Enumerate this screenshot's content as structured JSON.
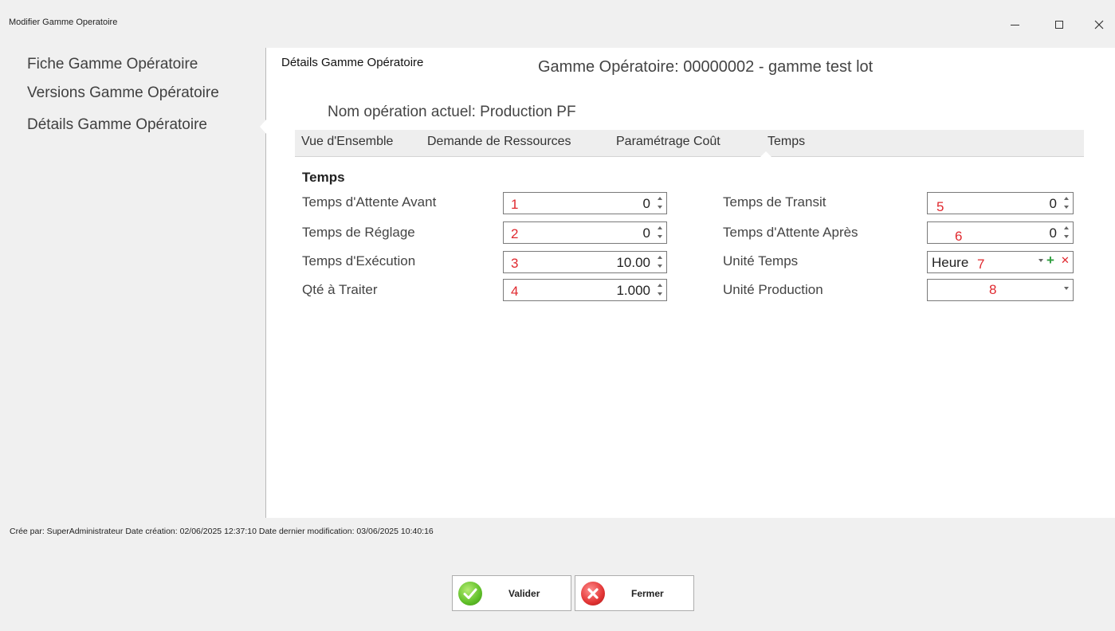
{
  "window": {
    "title": "Modifier Gamme Operatoire"
  },
  "sidebar": {
    "items": [
      {
        "label": "Fiche Gamme Opératoire"
      },
      {
        "label": "Versions Gamme Opératoire"
      },
      {
        "label": "Détails Gamme Opératoire"
      }
    ],
    "selected_index": 2
  },
  "main": {
    "section_title": "Détails Gamme Opératoire",
    "gamme_title": "Gamme Opératoire: 00000002 - gamme test lot",
    "operation_name": "Nom opération actuel: Production PF",
    "tabs": [
      {
        "label": "Vue d'Ensemble"
      },
      {
        "label": "Demande de Ressources"
      },
      {
        "label": "Paramétrage Coût"
      },
      {
        "label": "Temps"
      }
    ],
    "active_tab": "Temps",
    "group_title": "Temps",
    "fields": {
      "attente_avant": {
        "label": "Temps d'Attente Avant",
        "value": "0",
        "annotation": "1"
      },
      "reglage": {
        "label": "Temps de Réglage",
        "value": "0",
        "annotation": "2"
      },
      "execution": {
        "label": "Temps d'Exécution",
        "value": "10.00",
        "annotation": "3"
      },
      "qte": {
        "label": "Qté à Traiter",
        "value": "1.000",
        "annotation": "4"
      },
      "transit": {
        "label": "Temps de Transit",
        "value": "0",
        "annotation": "5"
      },
      "attente_apres": {
        "label": "Temps d'Attente Après",
        "value": "0",
        "annotation": "6"
      },
      "unite_temps": {
        "label": "Unité Temps",
        "value": "Heure",
        "annotation": "7"
      },
      "unite_production": {
        "label": "Unité Production",
        "value": "",
        "annotation": "8"
      }
    }
  },
  "footer": {
    "info": "Crée par: SuperAdministrateur Date création:  02/06/2025 12:37:10 Date dernier modification:  03/06/2025 10:40:16"
  },
  "buttons": {
    "validate_label": "Valider",
    "close_label": "Fermer"
  },
  "colors": {
    "annotation": "#e0282e",
    "add_green": "#2e9e3e",
    "panel_bg": "#ffffff",
    "window_bg": "#f0f0f0"
  }
}
